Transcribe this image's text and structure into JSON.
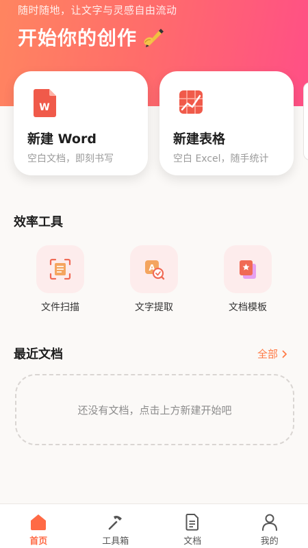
{
  "hero": {
    "subtitle": "随时随地，让文字与灵感自由流动",
    "title": "开始你的创作"
  },
  "cards": [
    {
      "title": "新建 Word",
      "desc": "空白文档，即刻书写",
      "icon": "word-doc-icon"
    },
    {
      "title": "新建表格",
      "desc": "空白 Excel，随手统计",
      "icon": "spreadsheet-icon"
    }
  ],
  "tools": {
    "title": "效率工具",
    "items": [
      {
        "label": "文件扫描",
        "icon": "scan-icon"
      },
      {
        "label": "文字提取",
        "icon": "text-extract-icon"
      },
      {
        "label": "文档模板",
        "icon": "template-icon"
      }
    ]
  },
  "recent": {
    "title": "最近文档",
    "see_all": "全部",
    "empty": "还没有文档，点击上方新建开始吧"
  },
  "tabs": [
    {
      "label": "首页",
      "icon": "home-icon",
      "active": true
    },
    {
      "label": "工具箱",
      "icon": "toolbox-icon",
      "active": false
    },
    {
      "label": "文档",
      "icon": "document-icon",
      "active": false
    },
    {
      "label": "我的",
      "icon": "profile-icon",
      "active": false
    }
  ],
  "colors": {
    "accent": "#ff6a45",
    "hero_start": "#ff8560",
    "hero_end": "#ff4f86",
    "tile_bg": "#fdecec"
  }
}
